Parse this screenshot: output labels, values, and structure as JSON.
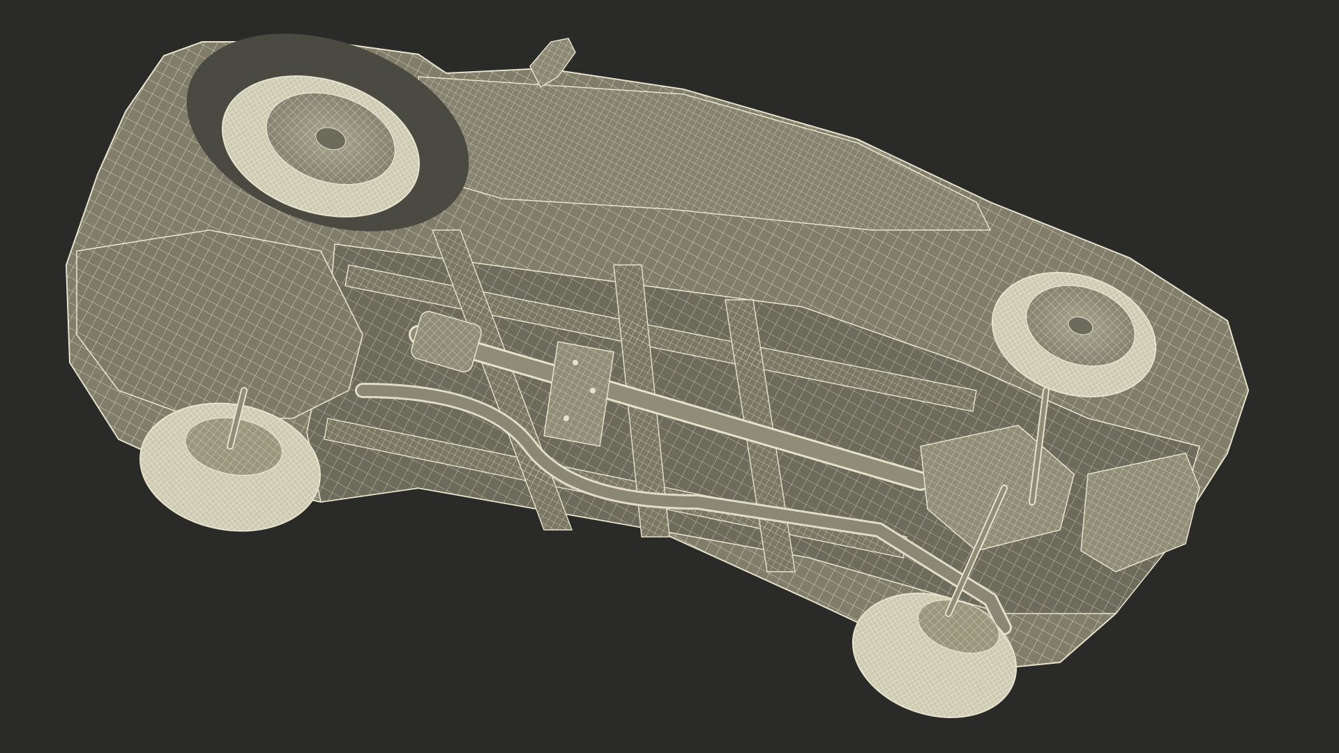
{
  "scene": {
    "subject": "wireframe-car-underside-render",
    "background_color": "#2a2a29",
    "body_fill": "#807d6a",
    "body_fill_dark": "#6d6b5b",
    "wire_color": "#e6e2cc",
    "tire_fill": "#cdcab4",
    "shadow_fill": "#4a4a42"
  }
}
